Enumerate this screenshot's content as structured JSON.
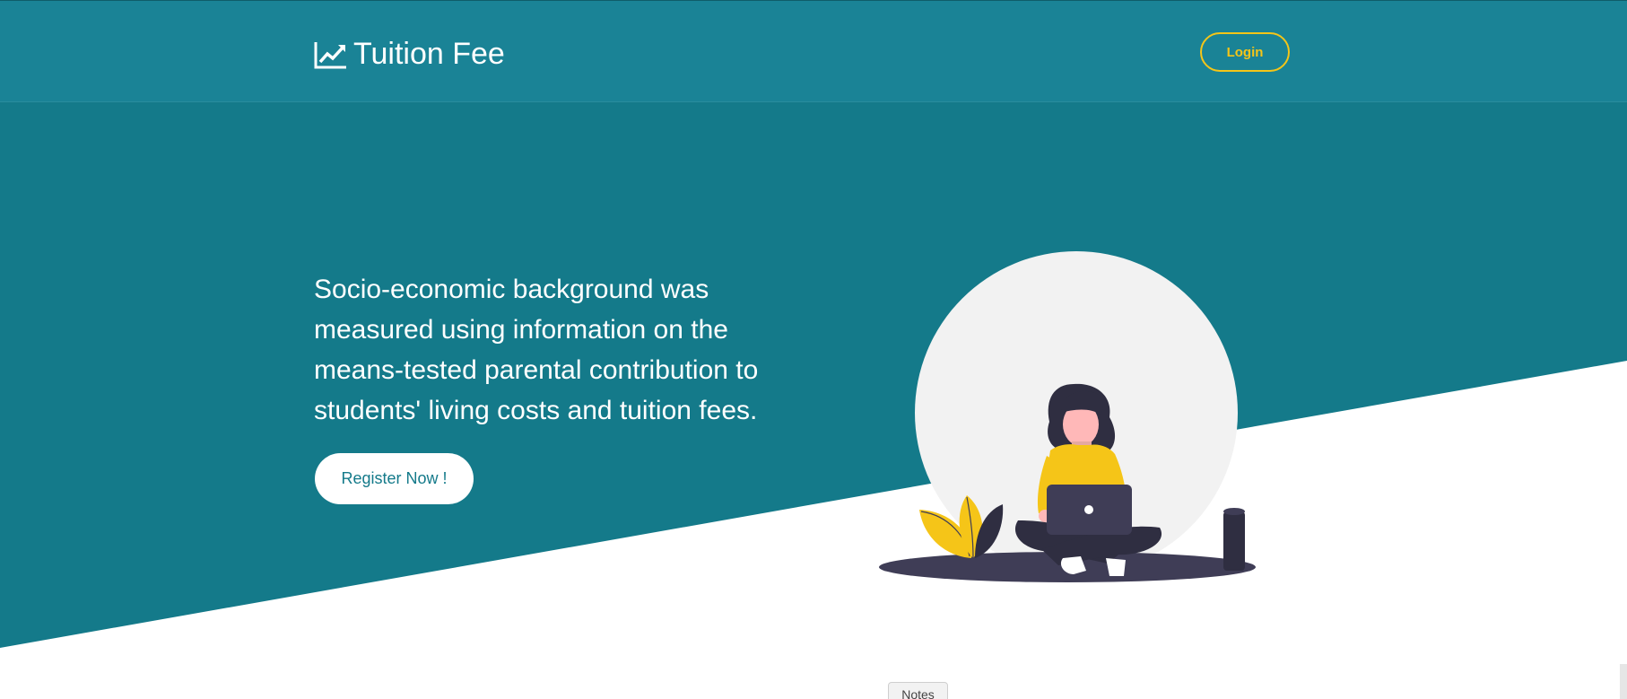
{
  "navbar": {
    "brand_icon": "chart-line-icon",
    "brand_text": "Tuition Fee",
    "login_label": "Login"
  },
  "hero": {
    "headline": "Socio-economic background was measured using information on the means-tested parental contribution to students' living costs and tuition fees.",
    "register_label": "Register Now !",
    "illustration": "woman-with-laptop-illustration"
  },
  "footer": {
    "notes_label": "Notes"
  },
  "colors": {
    "hero_teal": "#147a8a",
    "navbar_teal": "#1a8396",
    "accent_yellow": "#f5c518",
    "white": "#ffffff"
  }
}
